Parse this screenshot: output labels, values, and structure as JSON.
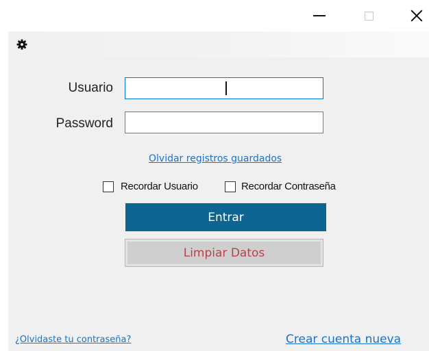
{
  "window": {
    "controls": {
      "minimize": "minimize-icon",
      "maximize": "maximize-icon",
      "close": "close-icon"
    }
  },
  "toolbar": {
    "settings_icon": "gear-icon"
  },
  "form": {
    "user_label": "Usuario",
    "user_value": "",
    "password_label": "Password",
    "password_value": "",
    "forget_saved_link": "Olvidar registros guardados",
    "remember_user_label": "Recordar Usuario",
    "remember_user_checked": false,
    "remember_password_label": "Recordar Contraseña",
    "remember_password_checked": false,
    "enter_button": "Entrar",
    "clear_button": "Limpiar Datos"
  },
  "footer": {
    "forgot_password_link": "¿Olvidaste tu contraseña?",
    "create_account_link": "Crear cuenta nueva"
  },
  "colors": {
    "enter_button_bg": "#0d6691",
    "clear_button_text": "#b5434b",
    "link": "#1a73c6",
    "focus_border": "#0078d7"
  }
}
